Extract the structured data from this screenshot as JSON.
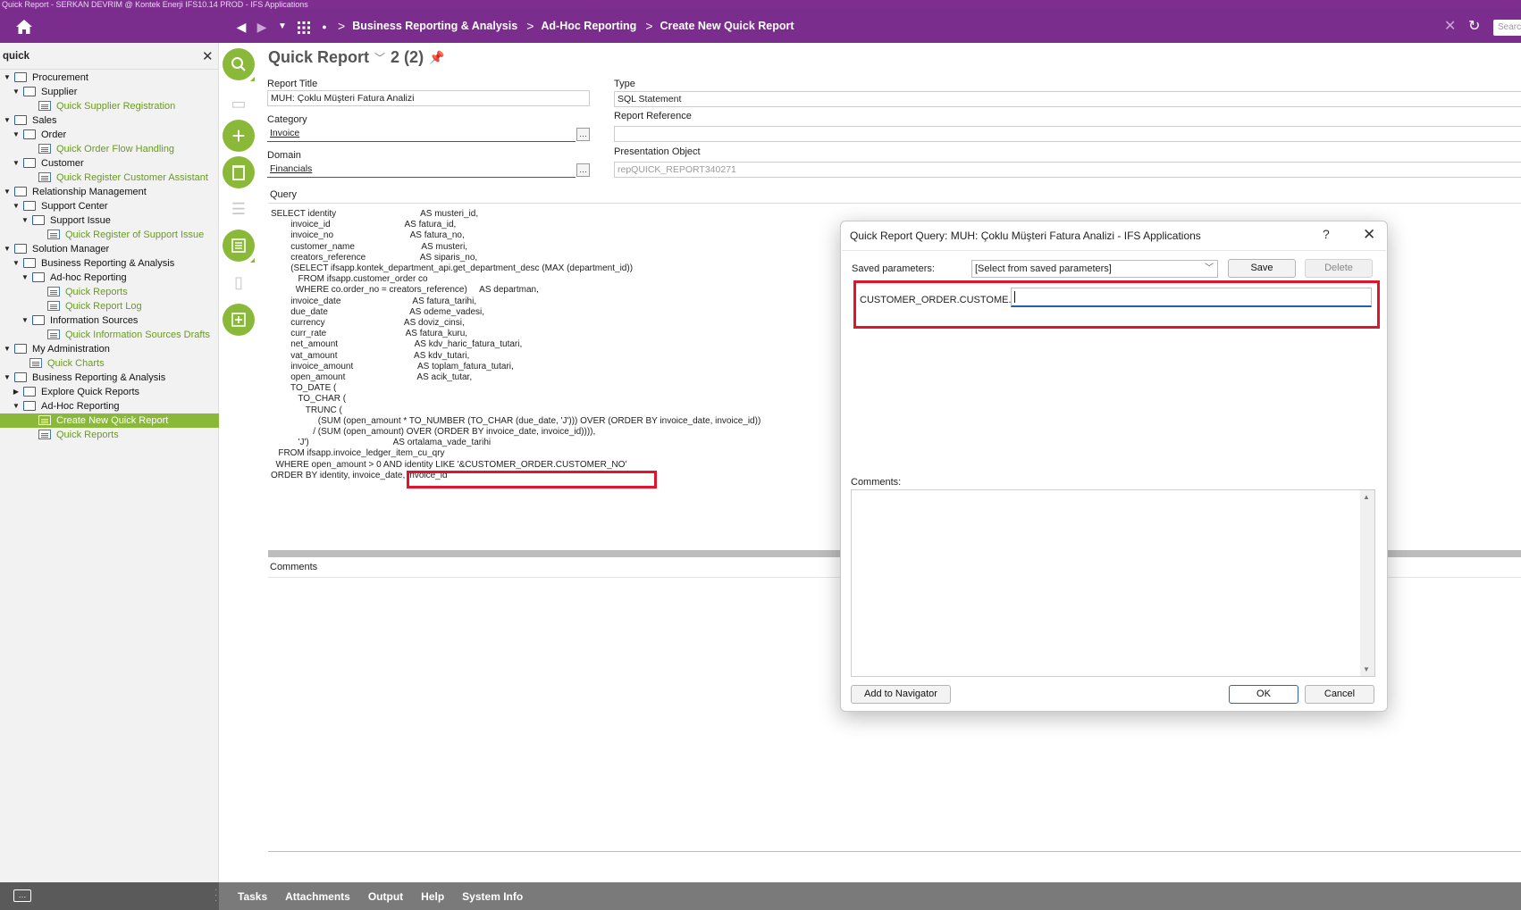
{
  "window": {
    "title": "Quick Report - SERKAN DEVRIM @ Kontek Enerji IFS10.14 PROD - IFS Applications"
  },
  "navbar": {
    "breadcrumbs": [
      "Business Reporting & Analysis",
      "Ad-Hoc Reporting",
      "Create New Quick Report"
    ],
    "search_placeholder": "Search"
  },
  "navigator": {
    "search_text": "quick",
    "items": [
      {
        "label": "Procurement",
        "depth": 0,
        "kind": "folder",
        "expanded": true
      },
      {
        "label": "Supplier",
        "depth": 1,
        "kind": "folder",
        "expanded": true
      },
      {
        "label": "Quick Supplier Registration",
        "depth": 2,
        "kind": "page"
      },
      {
        "label": "Sales",
        "depth": 0,
        "kind": "folder",
        "expanded": true
      },
      {
        "label": "Order",
        "depth": 1,
        "kind": "folder",
        "expanded": true
      },
      {
        "label": "Quick Order Flow Handling",
        "depth": 2,
        "kind": "page"
      },
      {
        "label": "Customer",
        "depth": 1,
        "kind": "folder",
        "expanded": true
      },
      {
        "label": "Quick Register Customer Assistant",
        "depth": 2,
        "kind": "page"
      },
      {
        "label": "Relationship Management",
        "depth": 0,
        "kind": "folder",
        "expanded": true
      },
      {
        "label": "Support Center",
        "depth": 1,
        "kind": "folder",
        "expanded": true
      },
      {
        "label": "Support Issue",
        "depth": 2,
        "kind": "folder",
        "expanded": true
      },
      {
        "label": "Quick Register of Support Issue",
        "depth": 3,
        "kind": "page"
      },
      {
        "label": "Solution Manager",
        "depth": 0,
        "kind": "folder",
        "expanded": true
      },
      {
        "label": "Business Reporting & Analysis",
        "depth": 1,
        "kind": "folder",
        "expanded": true
      },
      {
        "label": "Ad-hoc Reporting",
        "depth": 2,
        "kind": "folder",
        "expanded": true
      },
      {
        "label": "Quick Reports",
        "depth": 3,
        "kind": "page"
      },
      {
        "label": "Quick Report Log",
        "depth": 3,
        "kind": "page"
      },
      {
        "label": "Information Sources",
        "depth": 2,
        "kind": "folder",
        "expanded": true
      },
      {
        "label": "Quick Information Sources Drafts",
        "depth": 3,
        "kind": "page"
      },
      {
        "label": "My Administration",
        "depth": 0,
        "kind": "folder",
        "expanded": true
      },
      {
        "label": "Quick Charts",
        "depth": 1,
        "kind": "page"
      },
      {
        "label": "Business Reporting & Analysis",
        "depth": 0,
        "kind": "folder",
        "expanded": true
      },
      {
        "label": "Explore Quick Reports",
        "depth": 1,
        "kind": "folder",
        "expanded": false
      },
      {
        "label": "Ad-Hoc Reporting",
        "depth": 1,
        "kind": "folder",
        "expanded": true
      },
      {
        "label": "Create New Quick Report",
        "depth": 2,
        "kind": "page",
        "selected": true
      },
      {
        "label": "Quick Reports",
        "depth": 2,
        "kind": "page"
      }
    ]
  },
  "form": {
    "title": "Quick Report",
    "record_counter": "2 (2)",
    "report_title_label": "Report Title",
    "report_title_value": "MUH: Çoklu Müşteri Fatura Analizi",
    "type_label": "Type",
    "type_value": "SQL Statement",
    "category_label": "Category",
    "category_value": "Invoice",
    "report_reference_label": "Report Reference",
    "report_reference_value": "",
    "domain_label": "Domain",
    "domain_value": "Financials",
    "presentation_object_label": "Presentation Object",
    "presentation_object_value": "repQUICK_REPORT340271",
    "query_label": "Query",
    "query_text": "SELECT identity                                  AS musteri_id,\n        invoice_id                              AS fatura_id,\n        invoice_no                               AS fatura_no,\n        customer_name                           AS musteri,\n        creators_reference                      AS siparis_no,\n        (SELECT ifsapp.kontek_department_api.get_department_desc (MAX (department_id))\n           FROM ifsapp.customer_order co\n          WHERE co.order_no = creators_reference)     AS departman,\n        invoice_date                             AS fatura_tarihi,\n        due_date                                 AS odeme_vadesi,\n        currency                                AS doviz_cinsi,\n        curr_rate                                AS fatura_kuru,\n        net_amount                               AS kdv_haric_fatura_tutari,\n        vat_amount                               AS kdv_tutari,\n        invoice_amount                          AS toplam_fatura_tutari,\n        open_amount                             AS acik_tutar,\n        TO_DATE (\n           TO_CHAR (\n              TRUNC (\n                   (SUM (open_amount * TO_NUMBER (TO_CHAR (due_date, 'J'))) OVER (ORDER BY invoice_date, invoice_id))\n                 / (SUM (open_amount) OVER (ORDER BY invoice_date, invoice_id)))),\n           'J')                                  AS ortalama_vade_tarihi\n   FROM ifsapp.invoice_ledger_item_cu_qry\n  WHERE open_amount > 0 AND identity LIKE '&CUSTOMER_ORDER.CUSTOMER_NO'\nORDER BY identity, invoice_date, invoice_id",
    "comments_label": "Comments"
  },
  "dialog": {
    "title": "Quick Report Query: MUH: Çoklu Müşteri Fatura Analizi - IFS Applications",
    "help_label": "?",
    "saved_parameters_label": "Saved parameters:",
    "saved_parameters_value": "[Select from saved parameters]",
    "save_button": "Save",
    "delete_button": "Delete",
    "parameter_label": "CUSTOMER_ORDER.CUSTOME...",
    "parameter_value": "",
    "comments_label": "Comments:",
    "add_to_navigator_button": "Add to Navigator",
    "ok_button": "OK",
    "cancel_button": "Cancel"
  },
  "bottombar": {
    "tabs": [
      "Tasks",
      "Attachments",
      "Output",
      "Help",
      "System Info"
    ]
  },
  "colors": {
    "brand_purple": "#7b2d8e",
    "accent_green": "#8ab93a",
    "highlight_red": "#e0142a"
  }
}
